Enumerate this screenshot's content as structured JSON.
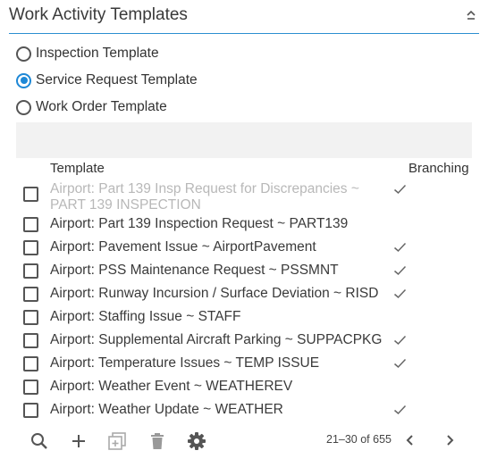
{
  "panel": {
    "title": "Work Activity Templates"
  },
  "template_types": [
    {
      "label": "Inspection Template",
      "selected": false
    },
    {
      "label": "Service Request Template",
      "selected": true
    },
    {
      "label": "Work Order Template",
      "selected": false
    }
  ],
  "search": {
    "value": ""
  },
  "table": {
    "columns": {
      "template": "Template",
      "branching": "Branching"
    },
    "rows": [
      {
        "label": "Airport: Part 139 Insp Request for Discrepancies ~ PART 139 INSPECTION",
        "branching": true,
        "disabled": true
      },
      {
        "label": "Airport: Part 139 Inspection Request ~ PART139",
        "branching": false,
        "disabled": false
      },
      {
        "label": "Airport: Pavement Issue ~ AirportPavement",
        "branching": true,
        "disabled": false
      },
      {
        "label": "Airport: PSS Maintenance Request ~ PSSMNT",
        "branching": true,
        "disabled": false
      },
      {
        "label": "Airport: Runway Incursion / Surface Deviation ~ RISD",
        "branching": true,
        "disabled": false
      },
      {
        "label": "Airport: Staffing Issue ~ STAFF",
        "branching": false,
        "disabled": false
      },
      {
        "label": "Airport: Supplemental Aircraft Parking ~ SUPPACPKG",
        "branching": true,
        "disabled": false
      },
      {
        "label": "Airport: Temperature Issues ~ TEMP ISSUE",
        "branching": true,
        "disabled": false
      },
      {
        "label": "Airport: Weather Event ~ WEATHEREV",
        "branching": false,
        "disabled": false
      },
      {
        "label": "Airport: Weather Update ~ WEATHER",
        "branching": true,
        "disabled": false
      }
    ]
  },
  "pagination": {
    "range": "21–30 of 655"
  },
  "toolbar": [
    "search-icon",
    "plus-icon",
    "copy-icon",
    "trash-icon",
    "gear-icon"
  ],
  "colors": {
    "accent": "#1e88d6",
    "header_rule": "#2b8fd0",
    "disabled_text": "#b8b8b8"
  }
}
